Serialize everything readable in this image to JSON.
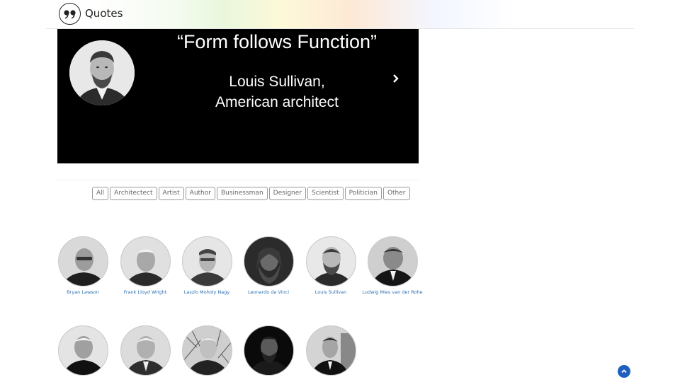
{
  "header": {
    "title": "Quotes",
    "logo_icon": "quote-marks-icon"
  },
  "hero": {
    "quote": "“Form follows Function”",
    "author_line1": "Louis Sullivan,",
    "author_line2": "American architect",
    "next_icon": "chevron-right-icon"
  },
  "filters": [
    "All",
    "Architectect",
    "Artist",
    "Author",
    "Businessman",
    "Designer",
    "Scientist",
    "Politician",
    "Other"
  ],
  "people_row1": [
    {
      "name": "Bryan Lawson"
    },
    {
      "name": "Frank Lloyd Wright"
    },
    {
      "name": "Laszlo Moholy Nagy"
    },
    {
      "name": "Leonardo da Vinci"
    },
    {
      "name": "Louis Sullivan"
    },
    {
      "name": "Ludwig Mies van der Rohe"
    }
  ],
  "colors": {
    "hero_bg": "#000000",
    "link": "#2a6fb0",
    "scroll_top": "#1f5fbf"
  }
}
